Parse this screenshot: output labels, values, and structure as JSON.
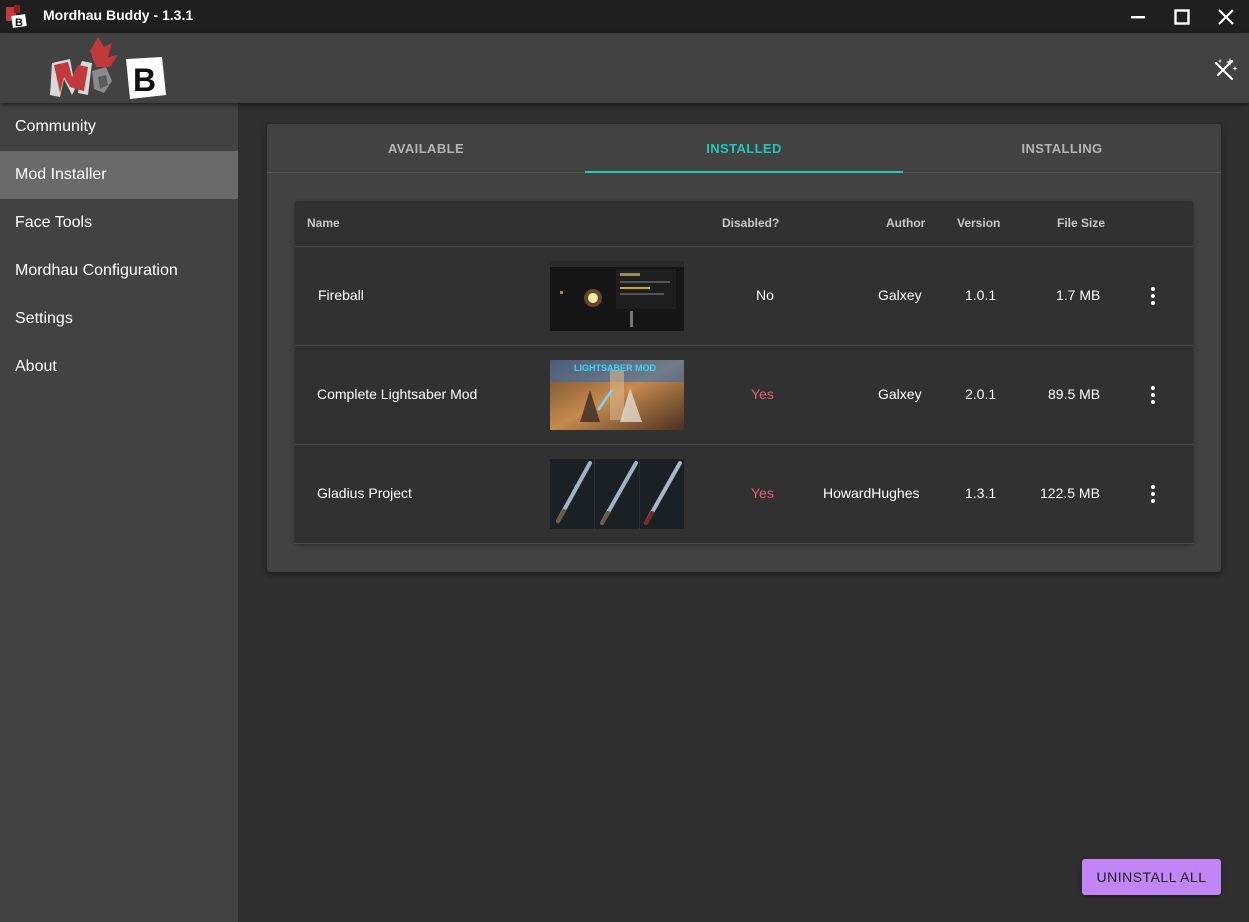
{
  "window": {
    "title": "Mordhau Buddy - 1.3.1",
    "controls": [
      "minimize-icon",
      "maximize-icon",
      "close-icon"
    ]
  },
  "header": {
    "logo_letter": "B",
    "theme_toggle_icon": "theme-toggle-icon"
  },
  "sidebar": {
    "items": [
      {
        "label": "Community",
        "active": false
      },
      {
        "label": "Mod Installer",
        "active": true
      },
      {
        "label": "Face Tools",
        "active": false
      },
      {
        "label": "Mordhau Configuration",
        "active": false
      },
      {
        "label": "Settings",
        "active": false
      },
      {
        "label": "About",
        "active": false
      }
    ]
  },
  "tabs": [
    {
      "label": "AVAILABLE",
      "active": false
    },
    {
      "label": "INSTALLED",
      "active": true
    },
    {
      "label": "INSTALLING",
      "active": false
    }
  ],
  "table": {
    "columns": [
      "Name",
      "Disabled?",
      "Author",
      "Version",
      "File Size"
    ],
    "rows": [
      {
        "name": "Fireball",
        "disabled": "No",
        "author": "Galxey",
        "version": "1.0.1",
        "size": "1.7 MB"
      },
      {
        "name": "Complete Lightsaber Mod",
        "disabled": "Yes",
        "author": "Galxey",
        "version": "2.0.1",
        "size": "89.5 MB",
        "thumb_text": "LIGHTSABER MOD"
      },
      {
        "name": "Gladius Project",
        "disabled": "Yes",
        "author": "HowardHughes",
        "version": "1.3.1",
        "size": "122.5 MB"
      }
    ]
  },
  "actions": {
    "uninstall_all": "UNINSTALL ALL"
  },
  "colors": {
    "accent_teal": "#26c6b8",
    "disabled_yes": "#e0607a",
    "button_purple": "#c285f5",
    "surface": "#424242",
    "background": "#303030"
  }
}
